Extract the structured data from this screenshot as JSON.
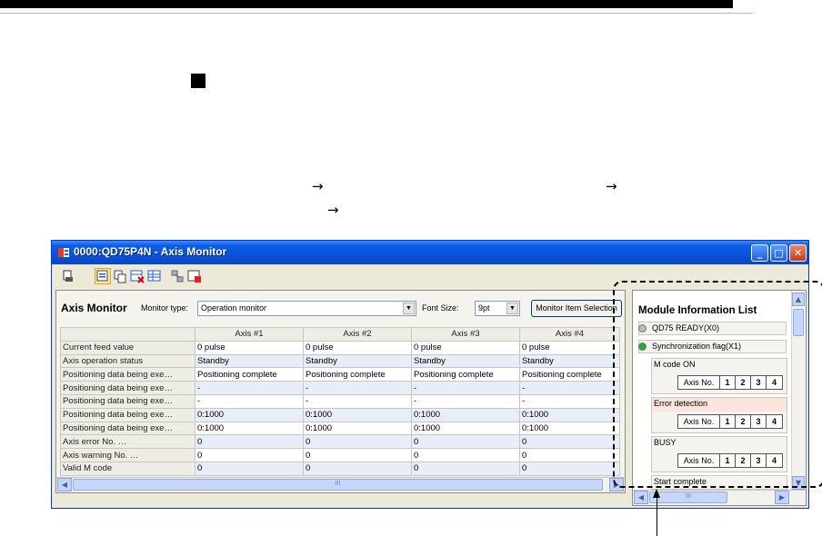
{
  "arrows": {
    "a1": "→",
    "a2": "→",
    "a3": "→"
  },
  "window": {
    "title": "0000:QD75P4N - Axis Monitor",
    "minimize": "_",
    "maximize": "□",
    "close": "✕"
  },
  "toolbar": {
    "icons": [
      "print-icon",
      "monitor-start-icon",
      "monitor-copy-icon",
      "delete-table-icon",
      "table-icon",
      "network-icon",
      "stop-monitor-icon"
    ]
  },
  "axis_monitor": {
    "title": "Axis Monitor",
    "monitor_type_label": "Monitor type:",
    "monitor_type_value": "Operation monitor",
    "font_size_label": "Font Size:",
    "font_size_value": "9pt",
    "monitor_item_button": "Monitor Item Selection",
    "columns": [
      "",
      "Axis #1",
      "Axis #2",
      "Axis #3",
      "Axis #4"
    ],
    "rows": [
      {
        "label": "Current feed value",
        "v": [
          "0 pulse",
          "0 pulse",
          "0 pulse",
          "0 pulse"
        ]
      },
      {
        "label": "Axis operation status",
        "v": [
          "Standby",
          "Standby",
          "Standby",
          "Standby"
        ]
      },
      {
        "label": "Positioning data being exe…",
        "v": [
          "Positioning complete",
          "Positioning complete",
          "Positioning complete",
          "Positioning complete"
        ]
      },
      {
        "label": "Positioning data being exe…",
        "v": [
          "-",
          "-",
          "-",
          "-"
        ]
      },
      {
        "label": "Positioning data being exe…",
        "v": [
          "-",
          "-",
          "-",
          "-"
        ]
      },
      {
        "label": "Positioning data being exe…",
        "v": [
          "0:1000",
          "0:1000",
          "0:1000",
          "0:1000"
        ]
      },
      {
        "label": "Positioning data being exe…",
        "v": [
          "0:1000",
          "0:1000",
          "0:1000",
          "0:1000"
        ]
      },
      {
        "label": "Axis error No. …",
        "v": [
          "0",
          "0",
          "0",
          "0"
        ]
      },
      {
        "label": "Axis warning No. …",
        "v": [
          "0",
          "0",
          "0",
          "0"
        ]
      },
      {
        "label": "Valid M code",
        "v": [
          "0",
          "0",
          "0",
          "0"
        ]
      }
    ],
    "scroll_grip": "III"
  },
  "module_info": {
    "title": "Module Information List",
    "qd75_ready": "QD75 READY(X0)",
    "sync_flag": "Synchronization flag(X1)",
    "m_code_on": "M code ON",
    "error_detection": "Error detection",
    "busy": "BUSY",
    "start_complete": "Start complete",
    "axis_no": "Axis No.",
    "axes": [
      "1",
      "2",
      "3",
      "4"
    ],
    "led_colors": {
      "off": "#b9b9b9",
      "on": "#1fae2c"
    },
    "scroll_grip": "III"
  }
}
